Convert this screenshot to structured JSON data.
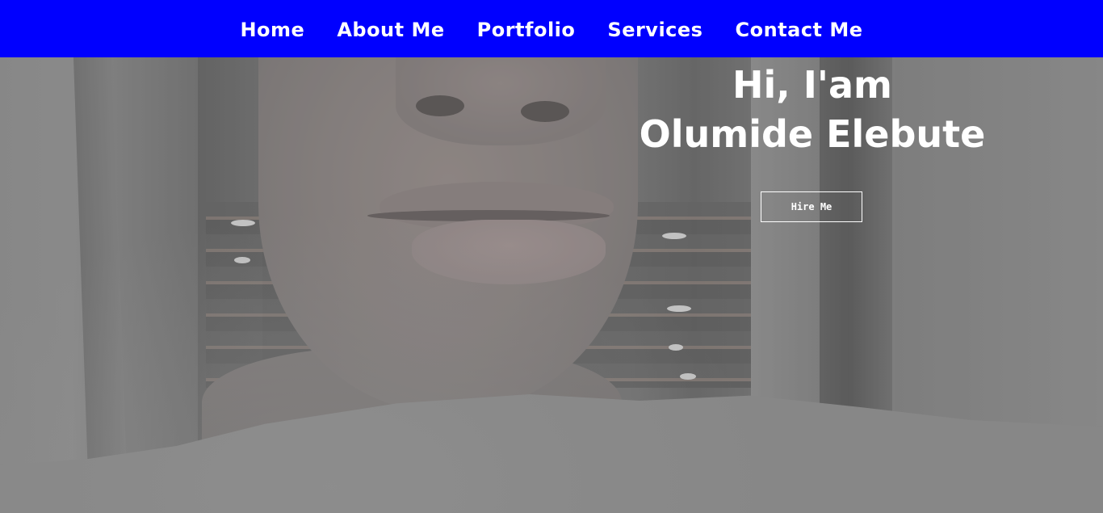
{
  "nav": {
    "items": [
      {
        "label": "Home"
      },
      {
        "label": "About Me"
      },
      {
        "label": "Portfolio"
      },
      {
        "label": "Services"
      },
      {
        "label": "Contact Me"
      }
    ]
  },
  "hero": {
    "greeting": "Hi, I'am",
    "name": "Olumide Elebute",
    "cta_label": "Hire Me"
  },
  "colors": {
    "navbar_bg": "#0000ff",
    "text": "#ffffff",
    "overlay": "#808080"
  }
}
